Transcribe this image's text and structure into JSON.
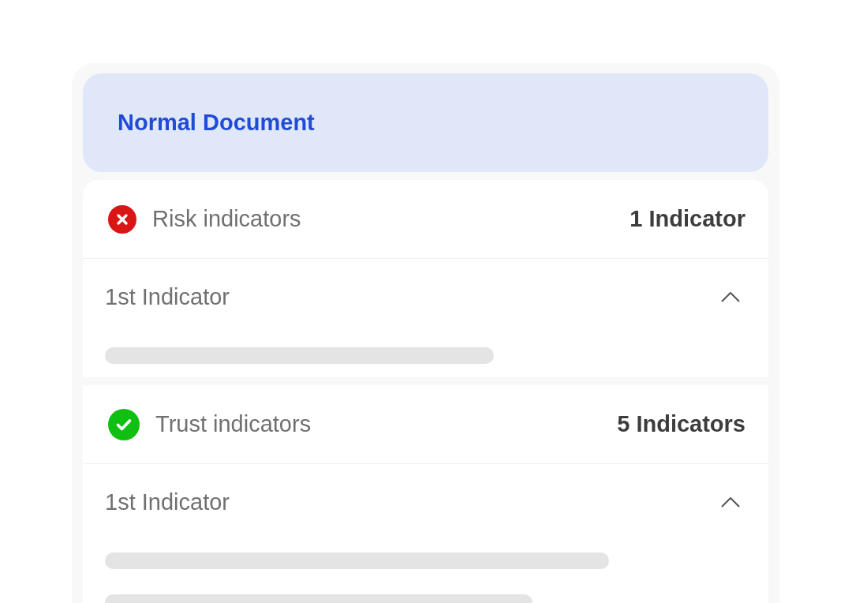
{
  "banner": {
    "title": "Normal Document"
  },
  "sections": [
    {
      "kind": "risk",
      "title": "Risk indicators",
      "count": "1 Indicator",
      "items": [
        {
          "title": "1st Indicator",
          "expanded": true,
          "lines": [
            {
              "kind": "skeleton"
            }
          ]
        }
      ]
    },
    {
      "kind": "trust",
      "title": "Trust indicators",
      "count": "5 Indicators",
      "items": [
        {
          "title": "1st Indicator",
          "expanded": true,
          "lines": [
            {
              "kind": "skeleton"
            },
            {
              "kind": "skeleton"
            }
          ]
        }
      ]
    }
  ]
}
